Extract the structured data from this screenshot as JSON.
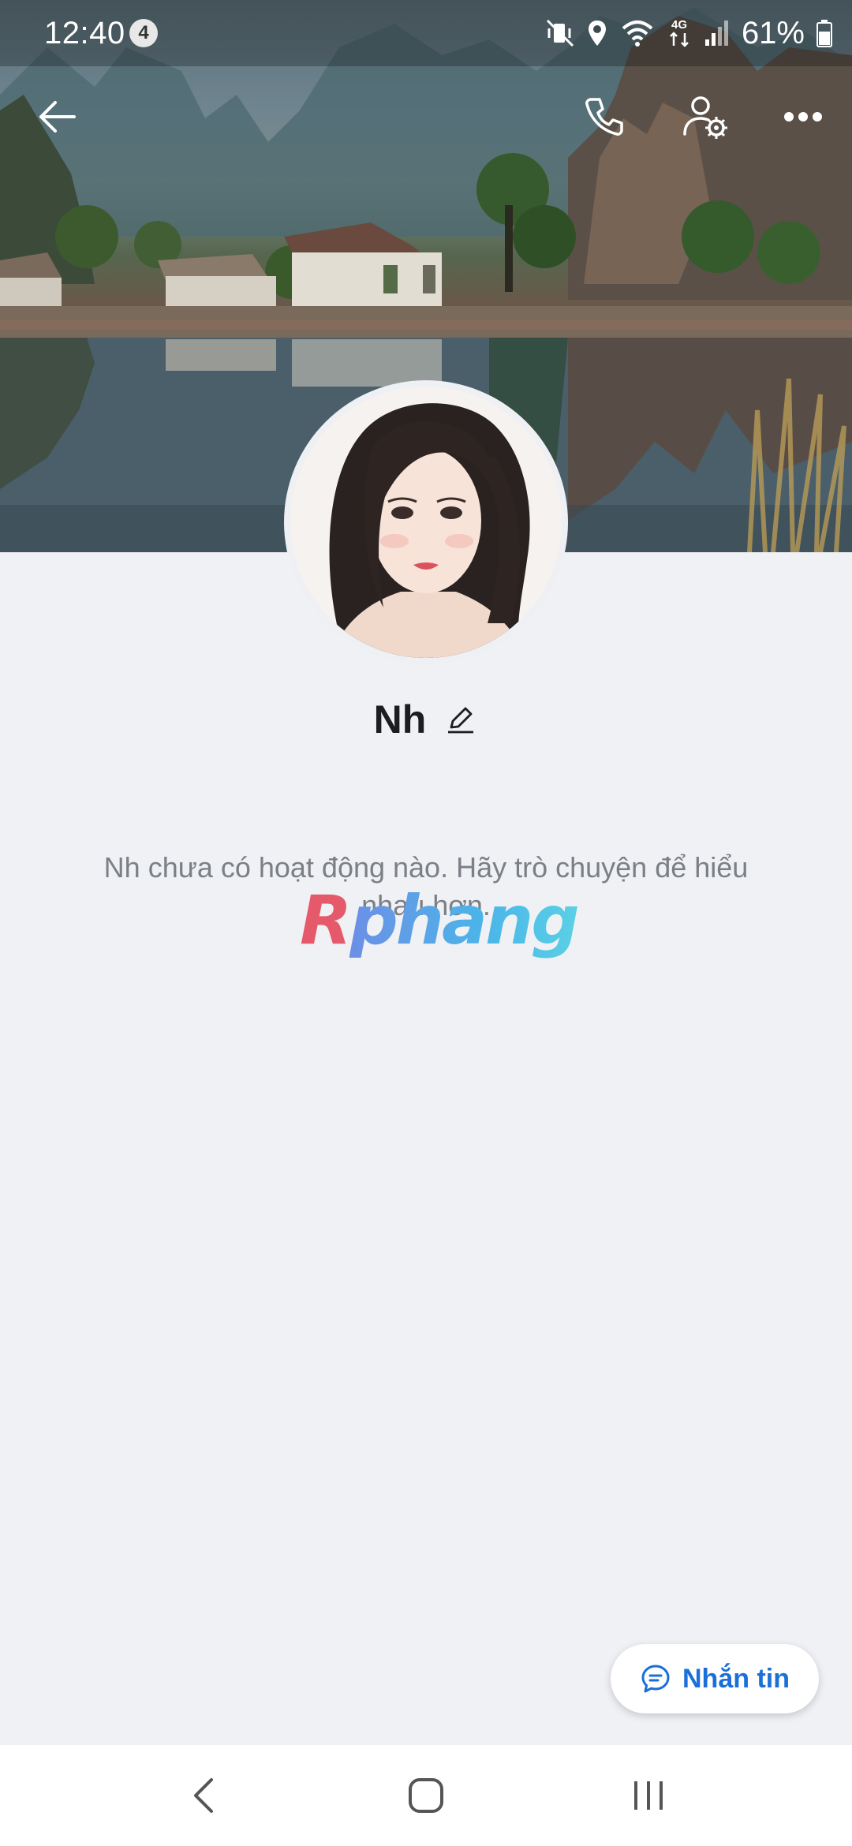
{
  "status_bar": {
    "time": "12:40",
    "notification_count": "4",
    "network": "4G",
    "battery": "61%"
  },
  "profile": {
    "name": "Nh",
    "empty_message": "Nh chưa có hoạt động nào. Hãy trò chuyện để hiểu nhau hơn."
  },
  "actions": {
    "message_label": "Nhắn tin"
  },
  "watermark": {
    "first": "R",
    "rest": "phang"
  },
  "colors": {
    "accent": "#1a6fd8",
    "background": "#f0f1f5"
  },
  "icons": [
    "back-arrow-icon",
    "phone-icon",
    "user-settings-icon",
    "more-options-icon",
    "edit-pencil-icon",
    "chat-bubble-icon"
  ]
}
